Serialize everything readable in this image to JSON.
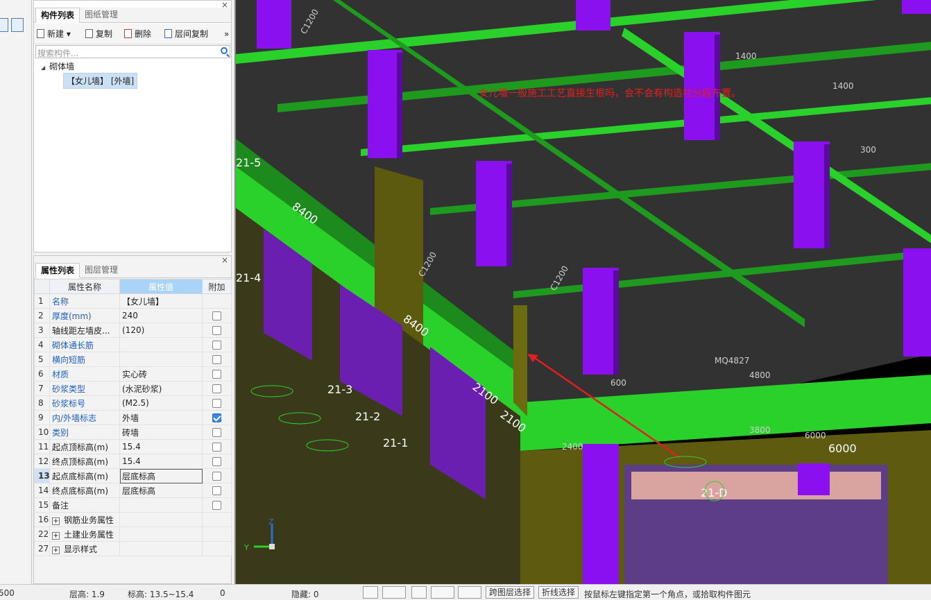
{
  "left_strip": {
    "icon1": "list-icon",
    "icon2": "grid-icon"
  },
  "component_panel": {
    "tabs": [
      "构件列表",
      "图纸管理"
    ],
    "toolbar": {
      "new": "新建",
      "copy": "复制",
      "delete": "删除",
      "floor_copy": "层间复制",
      "more": "»"
    },
    "search_placeholder": "搜索构件...",
    "tree": {
      "root": "砌体墙",
      "child": "【女儿墙】 [外墙]"
    }
  },
  "property_panel": {
    "tabs": [
      "属性列表",
      "图层管理"
    ],
    "headers": [
      "属性名称",
      "属性值",
      "附加"
    ],
    "rows": [
      {
        "num": "1",
        "name": "名称",
        "value": "【女儿墙】",
        "blue": true,
        "check": null
      },
      {
        "num": "2",
        "name": "厚度(mm)",
        "value": "240",
        "blue": true,
        "check": false
      },
      {
        "num": "3",
        "name": "轴线距左墙皮...",
        "value": "(120)",
        "blue": false,
        "check": false
      },
      {
        "num": "4",
        "name": "砌体通长筋",
        "value": "",
        "blue": true,
        "check": false
      },
      {
        "num": "5",
        "name": "横向短筋",
        "value": "",
        "blue": true,
        "check": false
      },
      {
        "num": "6",
        "name": "材质",
        "value": "实心砖",
        "blue": true,
        "check": false
      },
      {
        "num": "7",
        "name": "砂浆类型",
        "value": "(水泥砂浆)",
        "blue": true,
        "check": false
      },
      {
        "num": "8",
        "name": "砂浆标号",
        "value": "(M2.5)",
        "blue": true,
        "check": false
      },
      {
        "num": "9",
        "name": "内/外墙标志",
        "value": "外墙",
        "blue": true,
        "check": true
      },
      {
        "num": "10",
        "name": "类别",
        "value": "砖墙",
        "blue": true,
        "check": false
      },
      {
        "num": "11",
        "name": "起点顶标高(m)",
        "value": "15.4",
        "blue": false,
        "check": false
      },
      {
        "num": "12",
        "name": "终点顶标高(m)",
        "value": "15.4",
        "blue": false,
        "check": false
      },
      {
        "num": "13",
        "name": "起点底标高(m)",
        "value": "层底标高",
        "blue": false,
        "check": false
      },
      {
        "num": "14",
        "name": "终点底标高(m)",
        "value": "层底标高",
        "blue": false,
        "check": false
      },
      {
        "num": "15",
        "name": "备注",
        "value": "",
        "blue": false,
        "check": false
      }
    ],
    "groups": [
      {
        "num": "16",
        "name": "钢筋业务属性"
      },
      {
        "num": "22",
        "name": "土建业务属性"
      },
      {
        "num": "27",
        "name": "显示样式"
      }
    ]
  },
  "viewport": {
    "annotation": "女儿墙一般施工工艺直接生根吗，会不会有构造柱分段布置。",
    "axes": [
      "21-5",
      "21-4",
      "21-3",
      "21-2",
      "21-1",
      "21-D"
    ],
    "dims": [
      "8400",
      "8400",
      "2100",
      "2100",
      "6000",
      "4800",
      "3800",
      "6000",
      "2400",
      "1400",
      "1400",
      "300",
      "600"
    ],
    "labels": [
      "MQ4827",
      "C1200",
      "C1200",
      "C1200"
    ],
    "axis_z": "Z",
    "axis_y": "Y"
  },
  "status_bar": {
    "left_value": "500",
    "floor_height": "层高:  1.9",
    "elevation": "标高:  13.5~15.4",
    "zero": "0",
    "hidden": "隐藏:  0",
    "cross_layer": "跨图层选择",
    "polyline": "折线选择",
    "hint": "按鼠标左键指定第一个角点，或拾取构件图元"
  },
  "colors": {
    "purple_column": "#8a10ef",
    "green_beam": "#2bd12b",
    "slab": "#333333",
    "olive_wall": "#5b5a0e",
    "annotation_red": "#e02020",
    "accent_blue": "#2a6fd0"
  }
}
